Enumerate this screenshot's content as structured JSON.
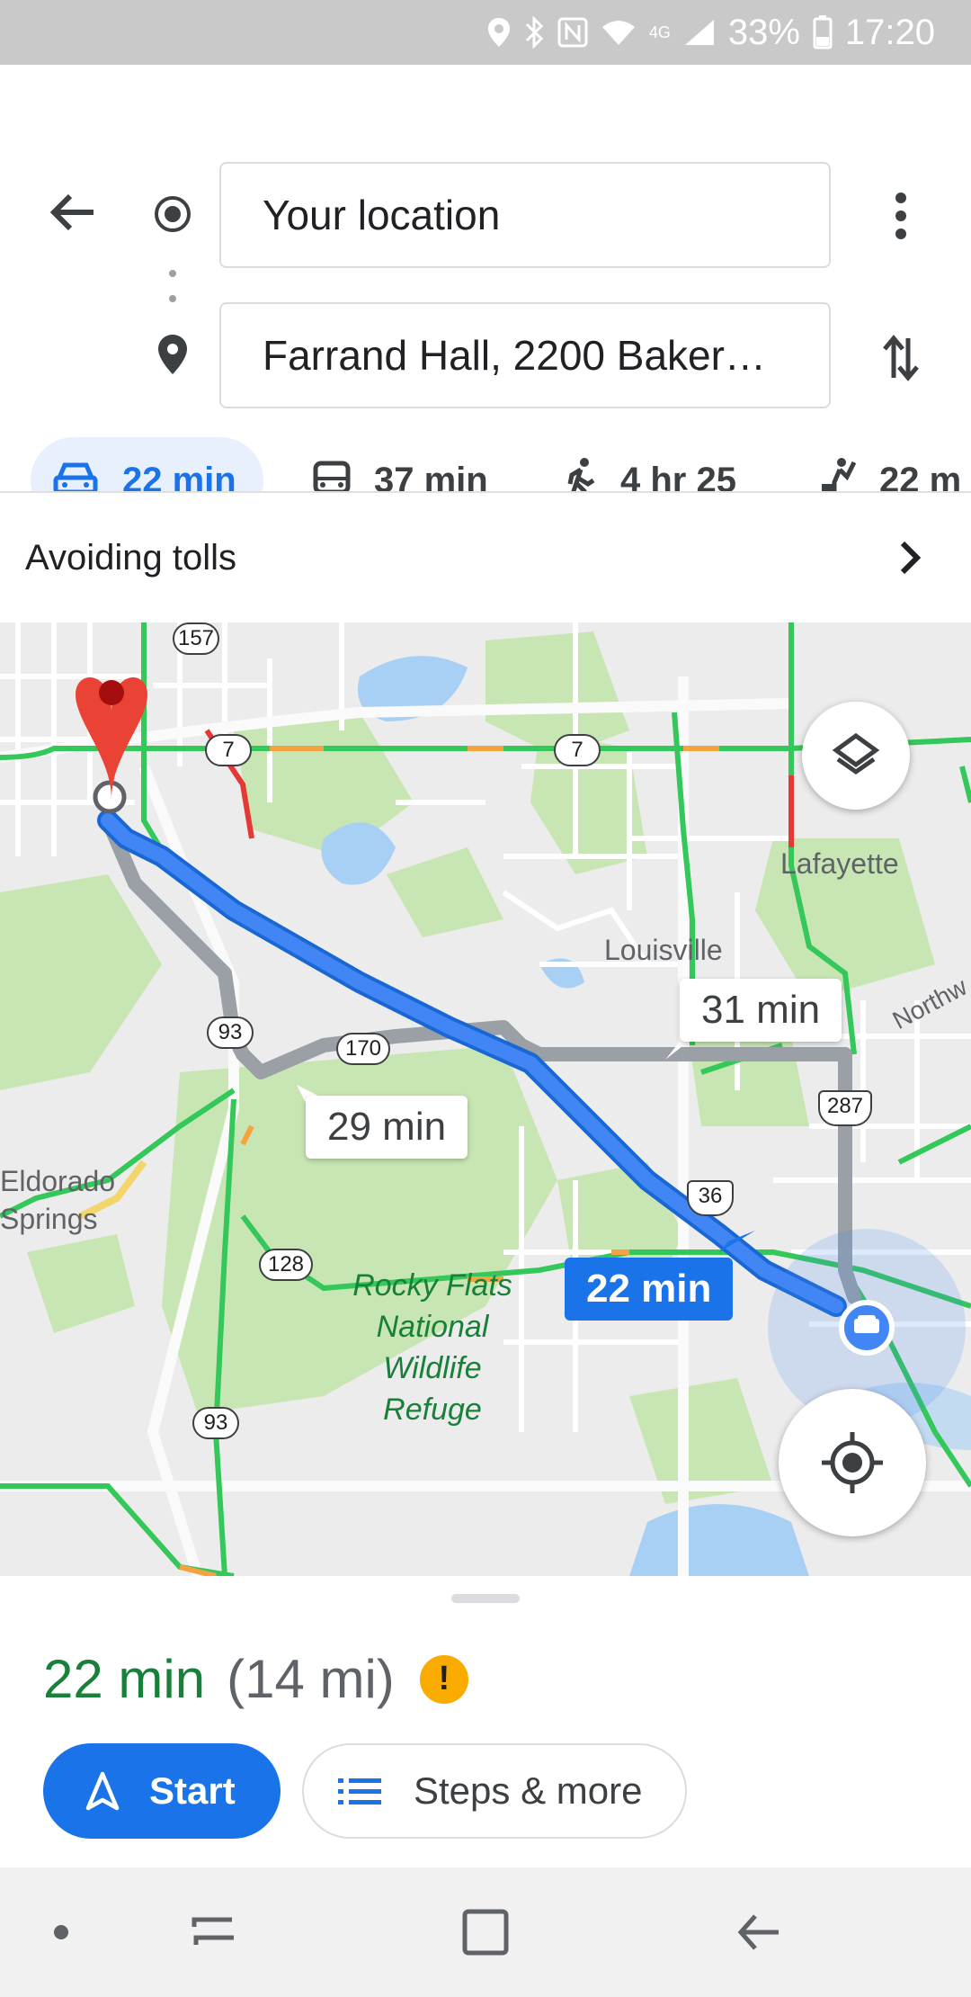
{
  "status_bar": {
    "battery": "33%",
    "time": "17:20",
    "network": "4G"
  },
  "directions": {
    "origin": {
      "value": "Your location"
    },
    "destination": {
      "value": "Farrand Hall, 2200 Baker…"
    }
  },
  "modes": [
    {
      "name": "drive",
      "label": "22 min",
      "active": true
    },
    {
      "name": "transit",
      "label": "37 min",
      "active": false
    },
    {
      "name": "walk",
      "label": "4 hr 25",
      "active": false
    },
    {
      "name": "ride",
      "label": "22 m",
      "active": false
    }
  ],
  "options_row": {
    "label": "Avoiding tolls"
  },
  "map": {
    "places": {
      "lafayette": "Lafayette",
      "louisville": "Louisville",
      "eldorado": "Eldorado\nSprings",
      "park": "Rocky Flats\nNational\nWildlife\nRefuge",
      "northwest": "Northw"
    },
    "route_times": {
      "primary": "22 min",
      "alt1": "29 min",
      "alt2": "31 min"
    },
    "shields": {
      "r157": "157",
      "r7a": "7",
      "r7b": "7",
      "r93a": "93",
      "r170": "170",
      "r287": "287",
      "r36": "36",
      "r128": "128",
      "r93b": "93"
    },
    "colors": {
      "route": "#4285f4",
      "alt_route": "#9aa0a6",
      "traffic_green": "#34c759",
      "traffic_orange": "#f4a340",
      "traffic_red": "#e53935",
      "park": "#c8e6b4",
      "water": "#a8d0f5"
    }
  },
  "summary": {
    "duration": "22 min",
    "distance": "(14 mi)",
    "warning": "!"
  },
  "actions": {
    "start": "Start",
    "steps": "Steps & more"
  }
}
